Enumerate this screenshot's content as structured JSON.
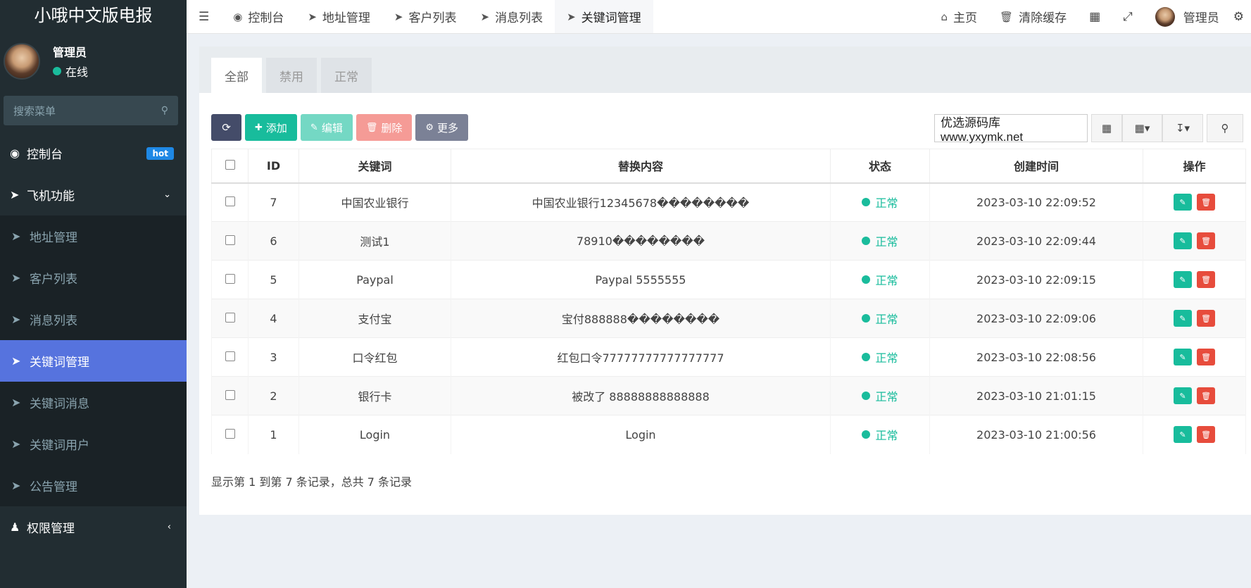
{
  "brand": "小哦中文版电报",
  "user": {
    "name": "管理员",
    "status": "在线"
  },
  "sidebar": {
    "search_placeholder": "搜索菜单",
    "dashboard": {
      "label": "控制台",
      "badge": "hot"
    },
    "group": {
      "label": "飞机功能"
    },
    "items": [
      {
        "label": "地址管理"
      },
      {
        "label": "客户列表"
      },
      {
        "label": "消息列表"
      },
      {
        "label": "关键词管理"
      },
      {
        "label": "关键词消息"
      },
      {
        "label": "关键词用户"
      },
      {
        "label": "公告管理"
      }
    ],
    "permission": {
      "label": "权限管理"
    }
  },
  "navbar": {
    "tabs": [
      {
        "label": "控制台"
      },
      {
        "label": "地址管理"
      },
      {
        "label": "客户列表"
      },
      {
        "label": "消息列表"
      },
      {
        "label": "关键词管理"
      }
    ],
    "home": "主页",
    "clear_cache": "清除缓存",
    "user": "管理员"
  },
  "filter_tabs": [
    {
      "label": "全部"
    },
    {
      "label": "禁用"
    },
    {
      "label": "正常"
    }
  ],
  "toolbar": {
    "add": "添加",
    "edit": "编辑",
    "delete": "删除",
    "more": "更多"
  },
  "search": {
    "value": "优选源码库 www.yxymk.net"
  },
  "table": {
    "headers": {
      "id": "ID",
      "keyword": "关键词",
      "replace": "替换内容",
      "status": "状态",
      "created": "创建时间",
      "ops": "操作"
    },
    "rows": [
      {
        "id": "7",
        "keyword": "中国农业银行",
        "replace": "中国农业银行12345678��������",
        "status": "正常",
        "created": "2023-03-10 22:09:52"
      },
      {
        "id": "6",
        "keyword": "测试1",
        "replace": "78910��������",
        "status": "正常",
        "created": "2023-03-10 22:09:44"
      },
      {
        "id": "5",
        "keyword": "Paypal",
        "replace": "Paypal 5555555",
        "status": "正常",
        "created": "2023-03-10 22:09:15"
      },
      {
        "id": "4",
        "keyword": "支付宝",
        "replace": "宝付888888��������",
        "status": "正常",
        "created": "2023-03-10 22:09:06"
      },
      {
        "id": "3",
        "keyword": "口令红包",
        "replace": "红包口令77777777777777777",
        "status": "正常",
        "created": "2023-03-10 22:08:56"
      },
      {
        "id": "2",
        "keyword": "银行卡",
        "replace": "被改了 88888888888888",
        "status": "正常",
        "created": "2023-03-10 21:01:15"
      },
      {
        "id": "1",
        "keyword": "Login",
        "replace": "Login",
        "status": "正常",
        "created": "2023-03-10 21:00:56"
      }
    ]
  },
  "pager_info": "显示第 1 到第 7 条记录，总共 7 条记录"
}
